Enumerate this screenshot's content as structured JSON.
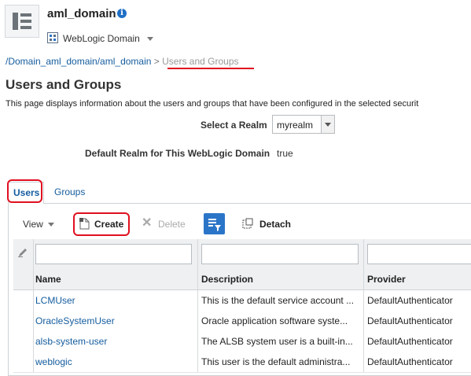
{
  "header": {
    "domain_name": "aml_domain",
    "domain_menu_label": "WebLogic Domain"
  },
  "breadcrumb": {
    "parent": "/Domain_aml_domain/aml_domain",
    "separator": ">",
    "current": "Users and Groups"
  },
  "page": {
    "title": "Users and Groups",
    "description": "This page displays information about the users and groups that have been configured in the selected securit"
  },
  "realm": {
    "label": "Select a Realm",
    "selected": "myrealm",
    "default_label": "Default Realm for This WebLogic Domain",
    "default_value": "true"
  },
  "tabs": [
    {
      "label": "Users",
      "selected": true
    },
    {
      "label": "Groups",
      "selected": false
    }
  ],
  "toolbar": {
    "view_label": "View",
    "create_label": "Create",
    "delete_label": "Delete",
    "detach_label": "Detach"
  },
  "table": {
    "columns": [
      "Name",
      "Description",
      "Provider"
    ],
    "rows": [
      {
        "name": "LCMUser",
        "description": "This is the default service account ...",
        "provider": "DefaultAuthenticator"
      },
      {
        "name": "OracleSystemUser",
        "description": "Oracle application software syste...",
        "provider": "DefaultAuthenticator"
      },
      {
        "name": "alsb-system-user",
        "description": "The ALSB system user is a built-in...",
        "provider": "DefaultAuthenticator"
      },
      {
        "name": "weblogic",
        "description": "This user is the default administra...",
        "provider": "DefaultAuthenticator"
      }
    ]
  },
  "colors": {
    "link": "#145c9e",
    "highlight": "#e01020",
    "accent": "#2a75c8"
  }
}
